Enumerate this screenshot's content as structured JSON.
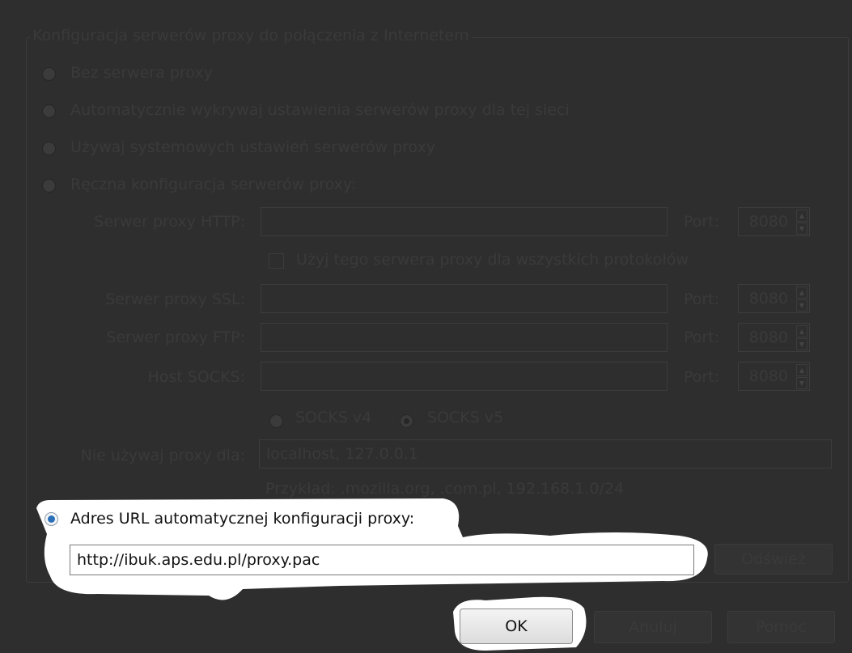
{
  "dialog": {
    "group_title": "Konfiguracja serwerów proxy do połączenia z Internetem",
    "options": {
      "no_proxy": "Bez serwera proxy",
      "auto_detect": "Automatycznie wykrywaj ustawienia serwerów proxy dla tej sieci",
      "system": "Używaj systemowych ustawień serwerów proxy",
      "manual": "Ręczna konfiguracja serwerów proxy:",
      "pac": "Adres URL automatycznej konfiguracji proxy:"
    },
    "manual": {
      "http_label": "Serwer proxy HTTP:",
      "http_value": "",
      "http_port": "8080",
      "same_proxy_label": "Użyj tego serwera proxy dla wszystkich protokołów",
      "ssl_label": "Serwer proxy SSL:",
      "ssl_value": "",
      "ssl_port": "8080",
      "ftp_label": "Serwer proxy FTP:",
      "ftp_value": "",
      "ftp_port": "8080",
      "socks_label": "Host SOCKS:",
      "socks_value": "",
      "socks_port": "8080",
      "port_label": "Port:",
      "socks_v4": "SOCKS v4",
      "socks_v5": "SOCKS v5",
      "no_proxy_label": "Nie używaj proxy dla:",
      "no_proxy_value": "localhost, 127.0.0.1",
      "example": "Przykład: .mozilla.org, .com.pl, 192.168.1.0/24"
    },
    "pac_url": "http://ibuk.aps.edu.pl/proxy.pac",
    "reload_button": "Odśwież",
    "buttons": {
      "ok": "OK",
      "cancel": "Anuluj",
      "help": "Pomoc"
    }
  }
}
